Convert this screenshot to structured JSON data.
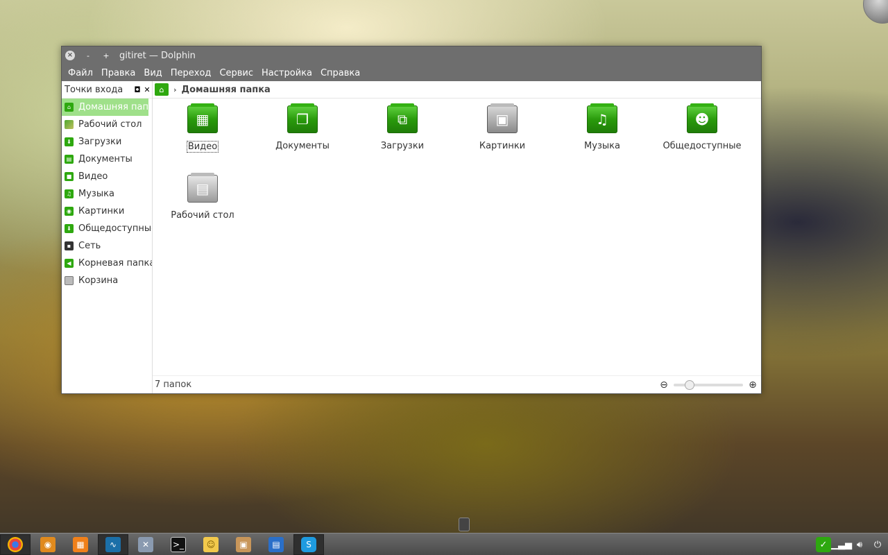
{
  "window": {
    "title": "gitiret — Dolphin",
    "controls": {
      "close": "×",
      "minimize": "-",
      "maximize": "+"
    }
  },
  "menu": [
    "Файл",
    "Правка",
    "Вид",
    "Переход",
    "Сервис",
    "Настройка",
    "Справка"
  ],
  "sidebar": {
    "header": "Точки входа",
    "items": [
      {
        "label": "Домашняя папк...",
        "icon": "home-icon",
        "active": true
      },
      {
        "label": "Рабочий стол",
        "icon": "desktop-icon"
      },
      {
        "label": "Загрузки",
        "icon": "downloads-icon"
      },
      {
        "label": "Документы",
        "icon": "documents-icon"
      },
      {
        "label": "Видео",
        "icon": "video-icon"
      },
      {
        "label": "Музыка",
        "icon": "music-icon"
      },
      {
        "label": "Картинки",
        "icon": "pictures-icon"
      },
      {
        "label": "Общедоступные",
        "icon": "public-icon"
      },
      {
        "label": "Сеть",
        "icon": "network-icon"
      },
      {
        "label": "Корневая папка",
        "icon": "root-icon"
      },
      {
        "label": "Корзина",
        "icon": "trash-icon"
      }
    ]
  },
  "breadcrumb": {
    "current": "Домашняя папка"
  },
  "folders": [
    {
      "label": "Видео",
      "icon": "video-folder-icon"
    },
    {
      "label": "Документы",
      "icon": "documents-folder-icon"
    },
    {
      "label": "Загрузки",
      "icon": "downloads-folder-icon"
    },
    {
      "label": "Картинки",
      "icon": "pictures-folder-icon"
    },
    {
      "label": "Музыка",
      "icon": "music-folder-icon"
    },
    {
      "label": "Общедоступные",
      "icon": "public-folder-icon"
    },
    {
      "label": "Рабочий стол",
      "icon": "desktop-folder-icon"
    }
  ],
  "status": {
    "text": "7 папок"
  },
  "taskbar": {
    "apps": [
      "chrome-icon",
      "eye-icon",
      "grid-icon",
      "monitor-icon",
      "tools-icon",
      "terminal-icon",
      "notes-icon",
      "package-icon",
      "document-icon",
      "skype-icon"
    ],
    "tray": [
      "check-icon",
      "signal-icon",
      "volume-icon",
      "power-icon"
    ]
  },
  "colors": {
    "accent": "#2ea80f",
    "active_item": "#9fe08a",
    "titlebar": "#6e6e6e"
  }
}
